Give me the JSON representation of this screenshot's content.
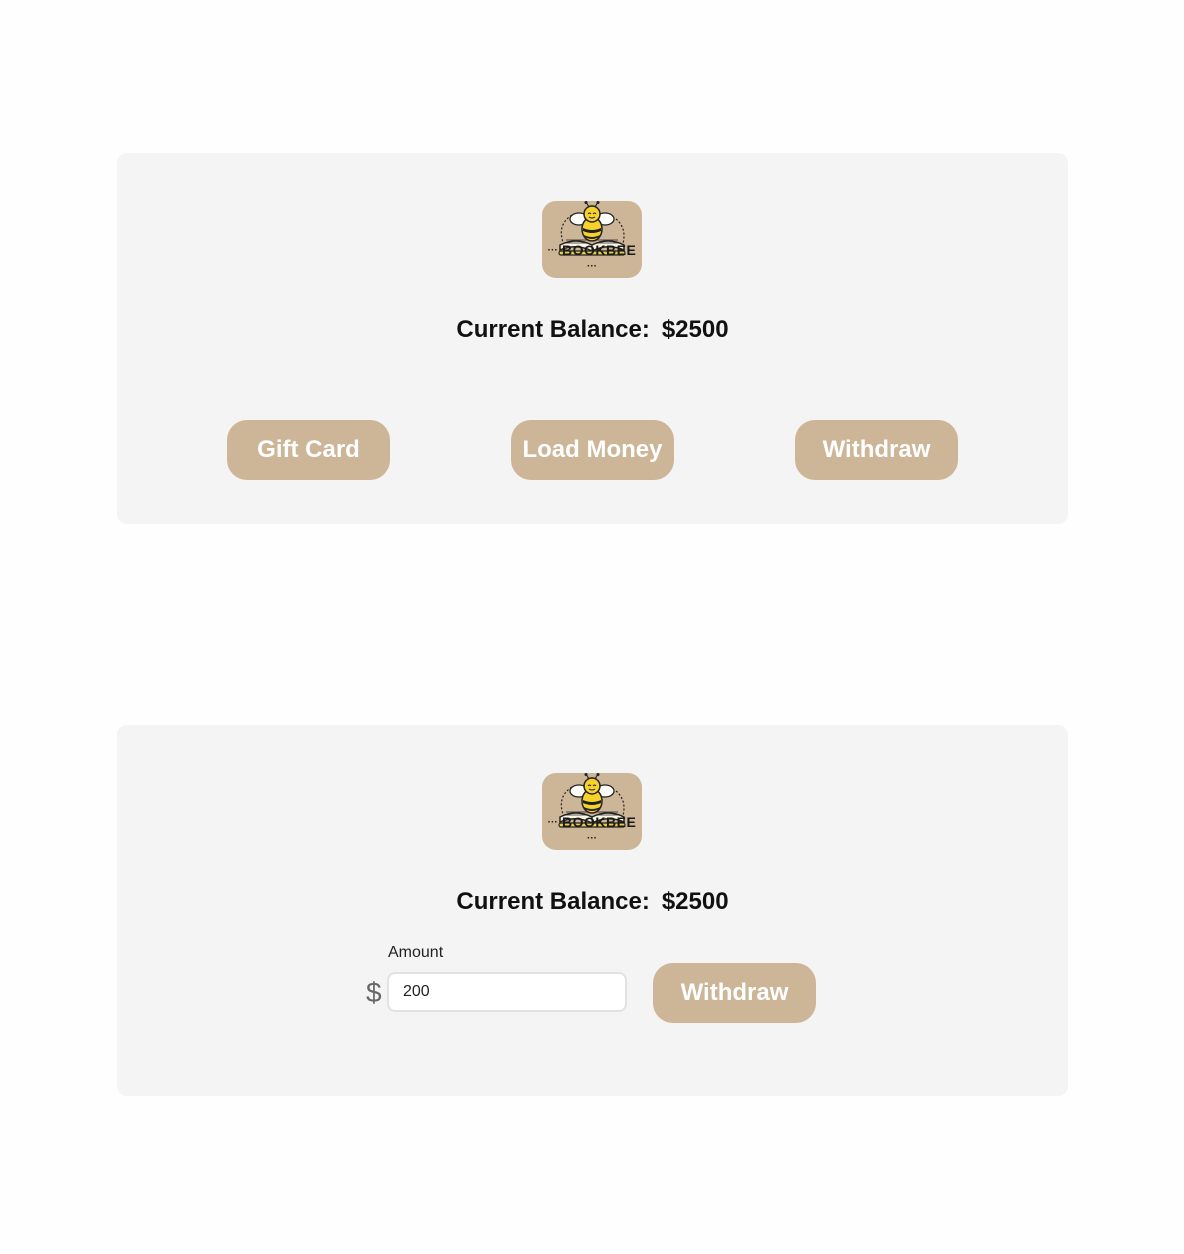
{
  "brand": {
    "logo_text": "BOOKBEE",
    "logo_bg": "#cdb597",
    "icon": "bee-on-book-icon"
  },
  "wallet_menu": {
    "balance_label": "Current Balance:",
    "balance_value": "$2500",
    "buttons": {
      "gift_card": "Gift Card",
      "load_money": "Load Money",
      "withdraw": "Withdraw"
    }
  },
  "withdraw_form": {
    "balance_label": "Current Balance:",
    "balance_value": "$2500",
    "amount_label": "Amount",
    "currency_symbol": "$",
    "amount_value": "200",
    "submit_label": "Withdraw"
  },
  "colors": {
    "accent": "#cdb597",
    "card_bg": "#f4f4f4",
    "page_bg": "#fefefe"
  }
}
